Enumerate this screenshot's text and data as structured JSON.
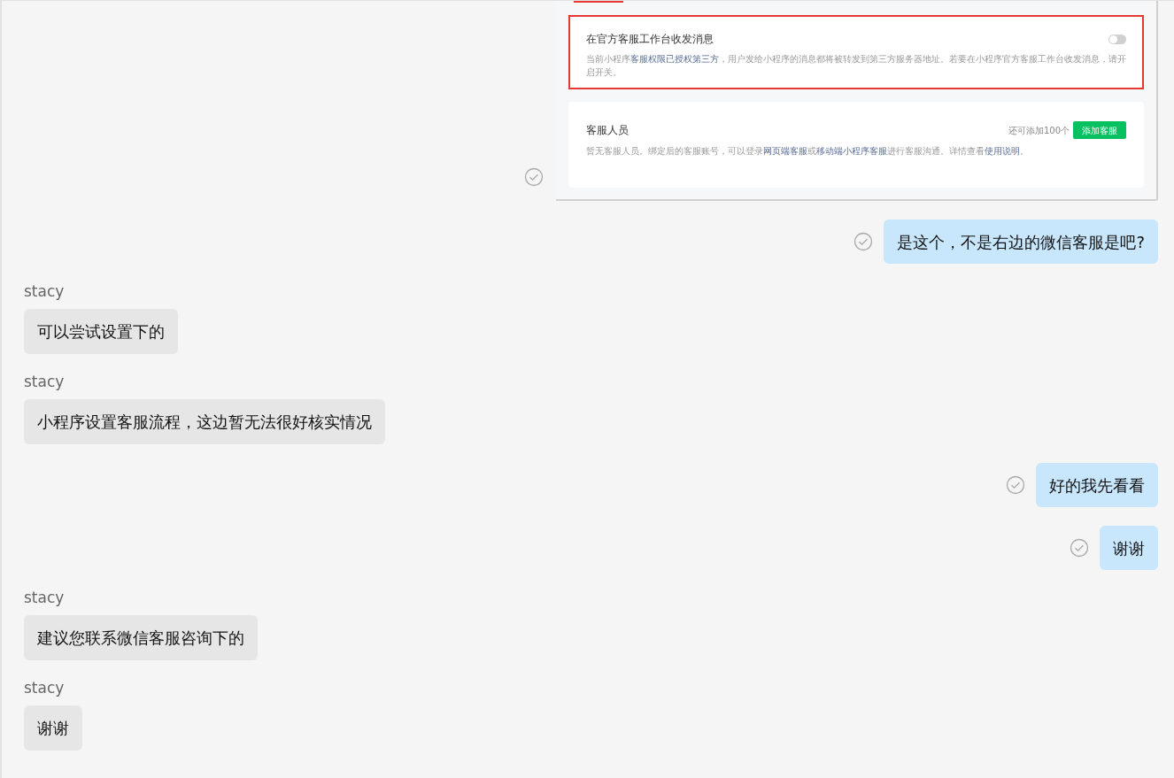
{
  "messages": [
    {
      "kind": "screenshot",
      "outgoing": true,
      "read": true,
      "panels": [
        {
          "title": "在官方客服工作台收发消息",
          "highlighted": true,
          "toggle": {
            "on": false
          },
          "description": [
            {
              "text": "当前小程序"
            },
            {
              "text": "客服权限已授权第三方",
              "link": true
            },
            {
              "text": "，用户发给小程序的消息都将被转发到第三方服务器地址。若要在小程序官方客服工作台收发消息，请开启开关。"
            }
          ]
        },
        {
          "title": "客服人员",
          "highlighted": false,
          "quota": "还可添加100个",
          "button": "添加客服",
          "description": [
            {
              "text": "暂无客服人员。绑定后的客服账号，可以登录"
            },
            {
              "text": "网页端客服",
              "link": true
            },
            {
              "text": "或"
            },
            {
              "text": "移动端小程序客服",
              "link": true
            },
            {
              "text": "进行客服沟通。详情查看"
            },
            {
              "text": "使用说明",
              "link": true
            },
            {
              "text": "。"
            }
          ]
        }
      ]
    },
    {
      "kind": "text",
      "outgoing": true,
      "read": true,
      "text": "是这个，不是右边的微信客服是吧?"
    },
    {
      "kind": "text",
      "outgoing": false,
      "sender": "stacy",
      "text": "可以尝试设置下的"
    },
    {
      "kind": "text",
      "outgoing": false,
      "sender": "stacy",
      "text": "小程序设置客服流程，这边暂无法很好核实情况"
    },
    {
      "kind": "text",
      "outgoing": true,
      "read": true,
      "text": "好的我先看看"
    },
    {
      "kind": "text",
      "outgoing": true,
      "read": true,
      "text": "谢谢"
    },
    {
      "kind": "text",
      "outgoing": false,
      "sender": "stacy",
      "text": "建议您联系微信客服咨询下的"
    },
    {
      "kind": "text",
      "outgoing": false,
      "sender": "stacy",
      "text": "谢谢"
    }
  ]
}
